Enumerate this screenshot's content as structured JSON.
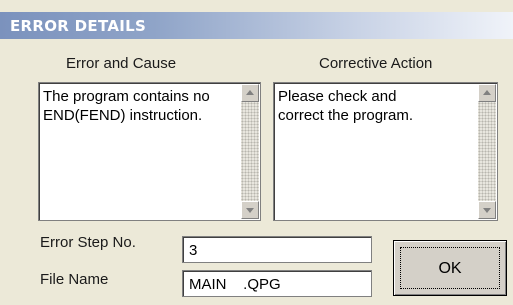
{
  "dialog": {
    "title": "ERROR DETAILS"
  },
  "error_cause": {
    "header": "Error and Cause",
    "text": "The program contains no\nEND(FEND) instruction."
  },
  "corrective_action": {
    "header": "Corrective Action",
    "text": "Please check and\ncorrect the program."
  },
  "fields": {
    "error_step_label": "Error Step No.",
    "error_step_value": "3",
    "file_name_label": "File Name",
    "file_name_value": "MAIN    .QPG"
  },
  "buttons": {
    "ok_label": "OK"
  },
  "colors": {
    "dialog_bg": "#ece9d8",
    "titlebar_start": "#7b92bd",
    "titlebar_end": "#f0f3f9"
  }
}
